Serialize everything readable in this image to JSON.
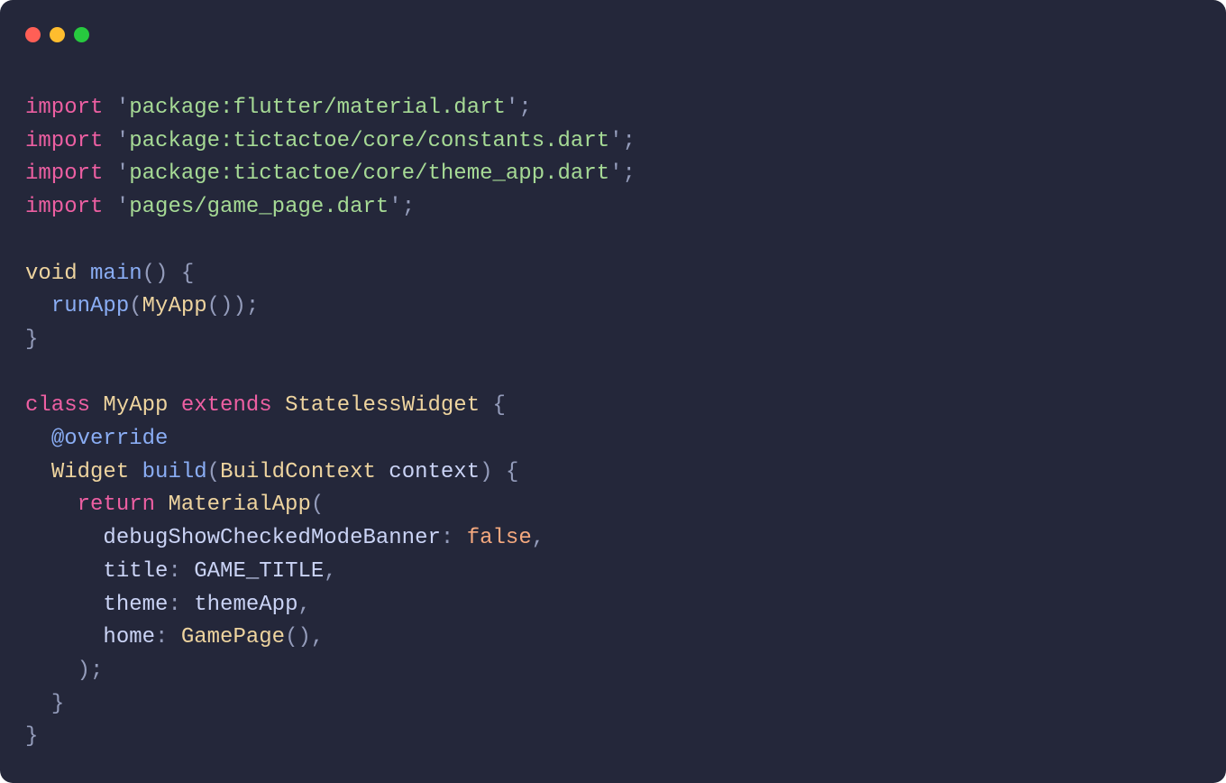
{
  "titlebar": {
    "dots": [
      "close",
      "minimize",
      "zoom"
    ]
  },
  "code": {
    "lines": [
      [
        {
          "c": "tk-kw",
          "t": "import"
        },
        {
          "c": "tk-plain",
          "t": " "
        },
        {
          "c": "tk-punct",
          "t": "'"
        },
        {
          "c": "tk-str",
          "t": "package:flutter/material.dart"
        },
        {
          "c": "tk-punct",
          "t": "'"
        },
        {
          "c": "tk-punct",
          "t": ";"
        }
      ],
      [
        {
          "c": "tk-kw",
          "t": "import"
        },
        {
          "c": "tk-plain",
          "t": " "
        },
        {
          "c": "tk-punct",
          "t": "'"
        },
        {
          "c": "tk-str",
          "t": "package:tictactoe/core/constants.dart"
        },
        {
          "c": "tk-punct",
          "t": "'"
        },
        {
          "c": "tk-punct",
          "t": ";"
        }
      ],
      [
        {
          "c": "tk-kw",
          "t": "import"
        },
        {
          "c": "tk-plain",
          "t": " "
        },
        {
          "c": "tk-punct",
          "t": "'"
        },
        {
          "c": "tk-str",
          "t": "package:tictactoe/core/theme_app.dart"
        },
        {
          "c": "tk-punct",
          "t": "'"
        },
        {
          "c": "tk-punct",
          "t": ";"
        }
      ],
      [
        {
          "c": "tk-kw",
          "t": "import"
        },
        {
          "c": "tk-plain",
          "t": " "
        },
        {
          "c": "tk-punct",
          "t": "'"
        },
        {
          "c": "tk-str",
          "t": "pages/game_page.dart"
        },
        {
          "c": "tk-punct",
          "t": "'"
        },
        {
          "c": "tk-punct",
          "t": ";"
        }
      ],
      [
        {
          "c": "tk-plain",
          "t": ""
        }
      ],
      [
        {
          "c": "tk-type",
          "t": "void"
        },
        {
          "c": "tk-plain",
          "t": " "
        },
        {
          "c": "tk-fn",
          "t": "main"
        },
        {
          "c": "tk-punct",
          "t": "()"
        },
        {
          "c": "tk-plain",
          "t": " "
        },
        {
          "c": "tk-punct",
          "t": "{"
        }
      ],
      [
        {
          "c": "tk-plain",
          "t": "  "
        },
        {
          "c": "tk-fn",
          "t": "runApp"
        },
        {
          "c": "tk-punct",
          "t": "("
        },
        {
          "c": "tk-type",
          "t": "MyApp"
        },
        {
          "c": "tk-punct",
          "t": "());"
        }
      ],
      [
        {
          "c": "tk-punct",
          "t": "}"
        }
      ],
      [
        {
          "c": "tk-plain",
          "t": ""
        }
      ],
      [
        {
          "c": "tk-kw",
          "t": "class"
        },
        {
          "c": "tk-plain",
          "t": " "
        },
        {
          "c": "tk-type",
          "t": "MyApp"
        },
        {
          "c": "tk-plain",
          "t": " "
        },
        {
          "c": "tk-kw",
          "t": "extends"
        },
        {
          "c": "tk-plain",
          "t": " "
        },
        {
          "c": "tk-type",
          "t": "StatelessWidget"
        },
        {
          "c": "tk-plain",
          "t": " "
        },
        {
          "c": "tk-punct",
          "t": "{"
        }
      ],
      [
        {
          "c": "tk-plain",
          "t": "  "
        },
        {
          "c": "tk-fn",
          "t": "@override"
        }
      ],
      [
        {
          "c": "tk-plain",
          "t": "  "
        },
        {
          "c": "tk-type",
          "t": "Widget"
        },
        {
          "c": "tk-plain",
          "t": " "
        },
        {
          "c": "tk-fn",
          "t": "build"
        },
        {
          "c": "tk-punct",
          "t": "("
        },
        {
          "c": "tk-type",
          "t": "BuildContext"
        },
        {
          "c": "tk-plain",
          "t": " "
        },
        {
          "c": "tk-plain",
          "t": "context"
        },
        {
          "c": "tk-punct",
          "t": ")"
        },
        {
          "c": "tk-plain",
          "t": " "
        },
        {
          "c": "tk-punct",
          "t": "{"
        }
      ],
      [
        {
          "c": "tk-plain",
          "t": "    "
        },
        {
          "c": "tk-kw",
          "t": "return"
        },
        {
          "c": "tk-plain",
          "t": " "
        },
        {
          "c": "tk-type",
          "t": "MaterialApp"
        },
        {
          "c": "tk-punct",
          "t": "("
        }
      ],
      [
        {
          "c": "tk-plain",
          "t": "      "
        },
        {
          "c": "tk-plain",
          "t": "debugShowCheckedModeBanner"
        },
        {
          "c": "tk-punct",
          "t": ":"
        },
        {
          "c": "tk-plain",
          "t": " "
        },
        {
          "c": "tk-const",
          "t": "false"
        },
        {
          "c": "tk-punct",
          "t": ","
        }
      ],
      [
        {
          "c": "tk-plain",
          "t": "      "
        },
        {
          "c": "tk-plain",
          "t": "title"
        },
        {
          "c": "tk-punct",
          "t": ":"
        },
        {
          "c": "tk-plain",
          "t": " "
        },
        {
          "c": "tk-plain",
          "t": "GAME_TITLE"
        },
        {
          "c": "tk-punct",
          "t": ","
        }
      ],
      [
        {
          "c": "tk-plain",
          "t": "      "
        },
        {
          "c": "tk-plain",
          "t": "theme"
        },
        {
          "c": "tk-punct",
          "t": ":"
        },
        {
          "c": "tk-plain",
          "t": " "
        },
        {
          "c": "tk-plain",
          "t": "themeApp"
        },
        {
          "c": "tk-punct",
          "t": ","
        }
      ],
      [
        {
          "c": "tk-plain",
          "t": "      "
        },
        {
          "c": "tk-plain",
          "t": "home"
        },
        {
          "c": "tk-punct",
          "t": ":"
        },
        {
          "c": "tk-plain",
          "t": " "
        },
        {
          "c": "tk-type",
          "t": "GamePage"
        },
        {
          "c": "tk-punct",
          "t": "(),"
        }
      ],
      [
        {
          "c": "tk-plain",
          "t": "    "
        },
        {
          "c": "tk-punct",
          "t": ");"
        }
      ],
      [
        {
          "c": "tk-plain",
          "t": "  "
        },
        {
          "c": "tk-punct",
          "t": "}"
        }
      ],
      [
        {
          "c": "tk-punct",
          "t": "}"
        }
      ]
    ]
  }
}
